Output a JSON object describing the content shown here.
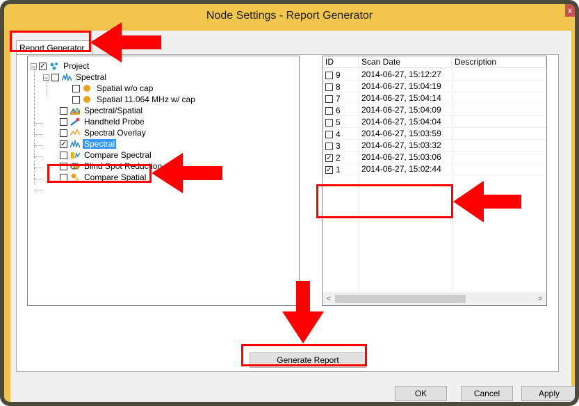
{
  "window": {
    "title": "Node Settings - Report Generator",
    "close_glyph": "x"
  },
  "tabs": [
    {
      "label": "Report Generator"
    },
    {
      "label": ""
    }
  ],
  "tree": {
    "items": [
      {
        "label": "Project",
        "checked": true,
        "icon": "project-icon"
      },
      {
        "label": "Spectral",
        "checked": false,
        "icon": "spectral-icon"
      },
      {
        "label": "Spatial w/o cap",
        "checked": false,
        "icon": "orange-dot-icon"
      },
      {
        "label": "Spatial 11.064 MHz w/ cap",
        "checked": false,
        "icon": "orange-dot-icon"
      },
      {
        "label": "Spectral/Spatial",
        "checked": false,
        "icon": "spectral-spatial-icon"
      },
      {
        "label": "Handheld Probe",
        "checked": false,
        "icon": "probe-icon"
      },
      {
        "label": "Spectral Overlay",
        "checked": false,
        "icon": "overlay-icon"
      },
      {
        "label": "Spectral",
        "checked": true,
        "icon": "spectral-icon",
        "selected": true
      },
      {
        "label": "Compare Spectral",
        "checked": false,
        "icon": "compare-spectral-icon"
      },
      {
        "label": "Blind Spot Reduction",
        "checked": false,
        "icon": "blind-spot-icon"
      },
      {
        "label": "Compare Spatial",
        "checked": false,
        "icon": "compare-spatial-icon"
      }
    ],
    "expander_minus": "−",
    "check_glyph": "✓"
  },
  "scans": {
    "columns": [
      "ID",
      "Scan Date",
      "Description"
    ],
    "rows": [
      {
        "id": "9",
        "date": "2014-06-27,  15:12:27",
        "checked": false
      },
      {
        "id": "8",
        "date": "2014-06-27,  15:04:19",
        "checked": false
      },
      {
        "id": "7",
        "date": "2014-06-27,  15:04:14",
        "checked": false
      },
      {
        "id": "6",
        "date": "2014-06-27,  15:04:09",
        "checked": false
      },
      {
        "id": "5",
        "date": "2014-06-27,  15:04:04",
        "checked": false
      },
      {
        "id": "4",
        "date": "2014-06-27,  15:03:59",
        "checked": false
      },
      {
        "id": "3",
        "date": "2014-06-27,  15:03:32",
        "checked": false
      },
      {
        "id": "2",
        "date": "2014-06-27,  15:03:06",
        "checked": true
      },
      {
        "id": "1",
        "date": "2014-06-27,  15:02:44",
        "checked": true
      }
    ],
    "scroll_left": "<",
    "scroll_right": ">"
  },
  "buttons": {
    "generate": "Generate Report",
    "ok": "OK",
    "cancel": "Cancel",
    "apply": "Apply"
  },
  "colors": {
    "titlebar": "#f1c64d",
    "highlight": "#ff0000",
    "selection": "#3399ff"
  }
}
